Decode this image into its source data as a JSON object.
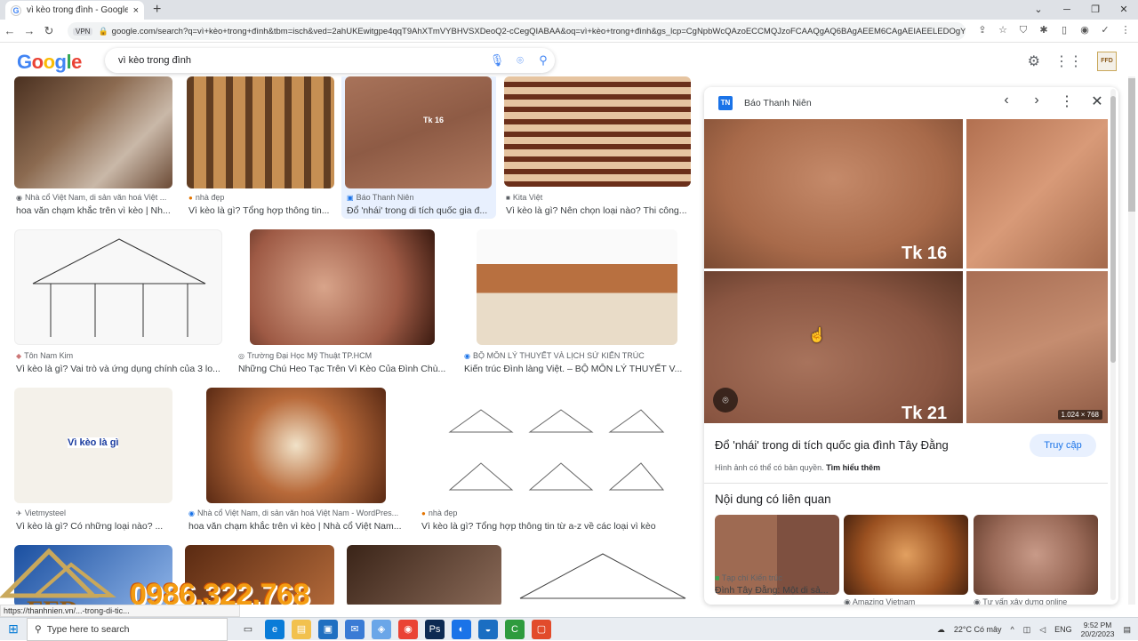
{
  "browser": {
    "tab_title": "vì kèo trong đình - Google Tìm k",
    "tab_close": "×",
    "new_tab": "+",
    "url": "google.com/search?q=vì+kèo+trong+đình&tbm=isch&ved=2ahUKEwitgpe4qqT9AhXTmVYBHVSXDeoQ2-cCegQIABAA&oq=vì+kèo+trong+đình&gs_lcp=CgNpbWcQAzoECCMQJzoFCAAQgAQ6BAgAEEM6CAgAEIAEELEDOgYIABAI...",
    "vpn": "VPN"
  },
  "search": {
    "query": "vì kèo trong đình"
  },
  "results": [
    {
      "source": "Nhà cổ Việt Nam, di sản văn hoá Việt ...",
      "caption": "hoa văn chạm khắc trên vì kèo | Nh..."
    },
    {
      "source": "nhà đẹp",
      "caption": "Vì kèo là gì? Tổng hợp thông tin..."
    },
    {
      "source": "Báo Thanh Niên",
      "caption": "Đổ 'nhái' trong di tích quốc gia đ..."
    },
    {
      "source": "Kita Việt",
      "caption": "Vì kèo là gì? Nên chọn loại nào? Thi công..."
    },
    {
      "source": "Tôn Nam Kim",
      "caption": "Vì kèo là gì? Vai trò và ứng dụng chính của 3 lo..."
    },
    {
      "source": "Trường Đại Học Mỹ Thuật TP.HCM",
      "caption": "Những Chú Heo Tạc Trên Vì Kèo Của Đình Chù..."
    },
    {
      "source": "BỘ MÔN LÝ THUYẾT VÀ LỊCH SỬ KIẾN TRÚC",
      "caption": "Kiến trúc Đình làng Việt. – BỘ MÔN LÝ THUYẾT V..."
    },
    {
      "source": "Vietmysteel",
      "caption": "Vì kèo là gì?  Có những loại nào? ..."
    },
    {
      "source": "Nhà cổ Việt Nam, di sản văn hoá Việt Nam - WordPres...",
      "caption": "hoa văn chạm khắc trên vì kèo | Nhà cổ Việt Nam..."
    },
    {
      "source": "nhà đẹp",
      "caption": "Vì kèo là gì? Tổng hợp thông tin từ a-z về các loại vì kèo"
    }
  ],
  "thumb_texts": {
    "vikeo_label": "Vì kèo là gì",
    "tk16": "Tk 16",
    "tk21": "Tk 21"
  },
  "panel": {
    "source": "Báo Thanh Niên",
    "source_logo": "TN",
    "title": "Đổ 'nhái' trong di tích quốc gia đình Tây Đằng",
    "visit": "Truy cập",
    "copyright": "Hình ảnh có thể có bản quyền.",
    "learn_more": "Tìm hiểu thêm",
    "dims": "1.024 × 768",
    "related_heading": "Nội dung có liên quan",
    "related": [
      {
        "source": "Tạp chí Kiến trúc",
        "caption": "Đình Tây Đằng: Một di sả..."
      },
      {
        "source": "Amazing Vietnam",
        "caption": ""
      },
      {
        "source": "Tư vấn xây dựng online",
        "caption": ""
      }
    ]
  },
  "overlay": {
    "phone": "0986.322.768",
    "status_url": "https://thanhnien.vn/...-trong-di-tic..."
  },
  "taskbar": {
    "search_placeholder": "Type here to search",
    "weather": "22°C  Có mây",
    "lang": "ENG",
    "time": "9:52 PM",
    "date": "20/2/2023"
  }
}
